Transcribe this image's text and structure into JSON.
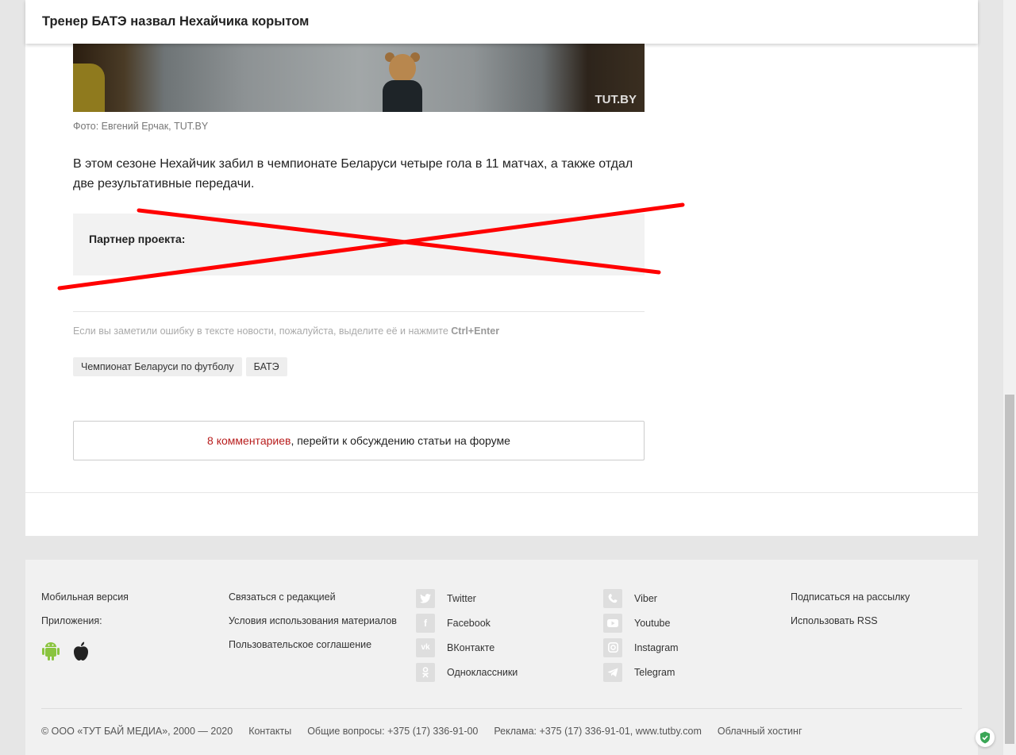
{
  "header": {
    "title": "Тренер БАТЭ назвал Нехайчика корытом"
  },
  "photo": {
    "watermark": "TUT.BY",
    "caption": "Фото: Евгений Ерчак, TUT.BY"
  },
  "article": {
    "paragraph": "В этом сезоне Нехайчик забил в чемпионате Беларуси четыре гола в 11 матчах, а также отдал две результативные передачи."
  },
  "partner": {
    "label": "Партнер проекта:"
  },
  "error_note": {
    "text": "Если вы заметили ошибку в тексте новости, пожалуйста, выделите её и нажмите ",
    "shortcut": "Ctrl+Enter"
  },
  "tags": [
    "Чемпионат Беларуси по футболу",
    "БАТЭ"
  ],
  "forum": {
    "count_text": "8 комментариев",
    "rest_text": ", перейти к обсуждению статьи на форуме"
  },
  "footer": {
    "col1": {
      "mobile": "Мобильная версия",
      "apps": "Приложения:"
    },
    "col2": [
      "Связаться с редакцией",
      "Условия использования материалов",
      "Пользовательское соглашение"
    ],
    "col3": [
      {
        "label": "Twitter",
        "icon": "twitter-icon"
      },
      {
        "label": "Facebook",
        "icon": "facebook-icon"
      },
      {
        "label": "ВКонтакте",
        "icon": "vk-icon"
      },
      {
        "label": "Одноклассники",
        "icon": "odnoklassniki-icon"
      }
    ],
    "col4": [
      {
        "label": "Viber",
        "icon": "viber-icon"
      },
      {
        "label": "Youtube",
        "icon": "youtube-icon"
      },
      {
        "label": "Instagram",
        "icon": "instagram-icon"
      },
      {
        "label": "Telegram",
        "icon": "telegram-icon"
      }
    ],
    "col5": [
      "Подписаться на рассылку",
      "Использовать RSS"
    ],
    "bottom": {
      "copyright": "© ООО «ТУТ БАЙ МЕДИА», 2000 — 2020",
      "contacts": "Контакты",
      "general": "Общие вопросы: +375 (17) 336-91-00",
      "ads": "Реклама: +375 (17) 336-91-01, www.tutby.com",
      "hosting": "Облачный хостинг"
    }
  },
  "colors": {
    "accent_red": "#b81d1d",
    "crossout": "#ff0000",
    "android_green": "#8ac43f"
  }
}
